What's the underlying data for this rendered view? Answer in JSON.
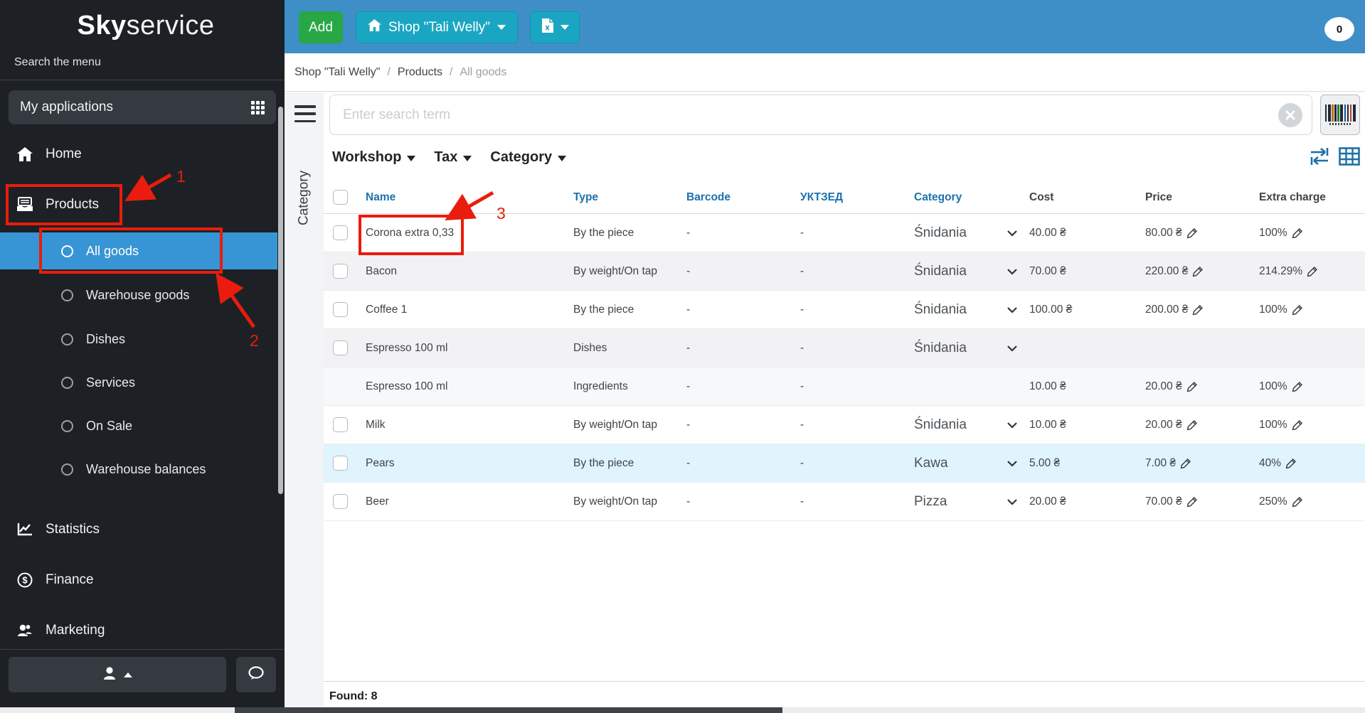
{
  "sidebar": {
    "logo_bold": "Sky",
    "logo_light": "service",
    "menu_search_placeholder": "Search the menu",
    "my_applications_label": "My applications",
    "home_label": "Home",
    "products_label": "Products",
    "sub_all_goods": "All goods",
    "sub_warehouse_goods": "Warehouse goods",
    "sub_dishes": "Dishes",
    "sub_services": "Services",
    "sub_on_sale": "On Sale",
    "sub_warehouse_balances": "Warehouse balances",
    "statistics_label": "Statistics",
    "finance_label": "Finance",
    "marketing_label": "Marketing"
  },
  "topbar": {
    "add_label": "Add",
    "shop_label": "Shop \"Tali Welly\"",
    "chat_count": "0"
  },
  "breadcrumb": {
    "shop": "Shop \"Tali Welly\"",
    "products": "Products",
    "current": "All goods",
    "separator": "/"
  },
  "search": {
    "placeholder": "Enter search term"
  },
  "filters": {
    "workshop": "Workshop",
    "tax": "Tax",
    "category": "Category"
  },
  "side_label": "Category",
  "table": {
    "headers": {
      "name": "Name",
      "type": "Type",
      "barcode": "Barcode",
      "uktzed": "УКТЗЕД",
      "category": "Category",
      "cost": "Cost",
      "price": "Price",
      "extra": "Extra charge"
    },
    "rows": [
      {
        "name": "Corona extra 0,33",
        "type": "By the piece",
        "barcode": "-",
        "uktzed": "-",
        "category": "Śnidania",
        "cost": "40.00 ₴",
        "price": "80.00 ₴",
        "extra": "100%"
      },
      {
        "name": "Bacon",
        "type": "By weight/On tap",
        "barcode": "-",
        "uktzed": "-",
        "category": "Śnidania",
        "cost": "70.00 ₴",
        "price": "220.00 ₴",
        "extra": "214.29%"
      },
      {
        "name": "Coffee 1",
        "type": "By the piece",
        "barcode": "-",
        "uktzed": "-",
        "category": "Śnidania",
        "cost": "100.00 ₴",
        "price": "200.00 ₴",
        "extra": "100%"
      },
      {
        "name": "Espresso 100 ml",
        "type": "Dishes",
        "barcode": "-",
        "uktzed": "-",
        "category": "Śnidania",
        "cost": "",
        "price": "",
        "extra": ""
      },
      {
        "name": "Espresso 100 ml",
        "type": "Ingredients",
        "barcode": "-",
        "uktzed": "-",
        "category": "",
        "cost": "10.00 ₴",
        "price": "20.00 ₴",
        "extra": "100%"
      },
      {
        "name": "Milk",
        "type": "By weight/On tap",
        "barcode": "-",
        "uktzed": "-",
        "category": "Śnidania",
        "cost": "10.00 ₴",
        "price": "20.00 ₴",
        "extra": "100%"
      },
      {
        "name": "Pears",
        "type": "By the piece",
        "barcode": "-",
        "uktzed": "-",
        "category": "Kawa",
        "cost": "5.00 ₴",
        "price": "7.00 ₴",
        "extra": "40%"
      },
      {
        "name": "Beer",
        "type": "By weight/On tap",
        "barcode": "-",
        "uktzed": "-",
        "category": "Pizza",
        "cost": "20.00 ₴",
        "price": "70.00 ₴",
        "extra": "250%"
      }
    ]
  },
  "footer": {
    "found": "Found: 8"
  },
  "annotations": {
    "step1": "1",
    "step2": "2",
    "step3": "3"
  }
}
